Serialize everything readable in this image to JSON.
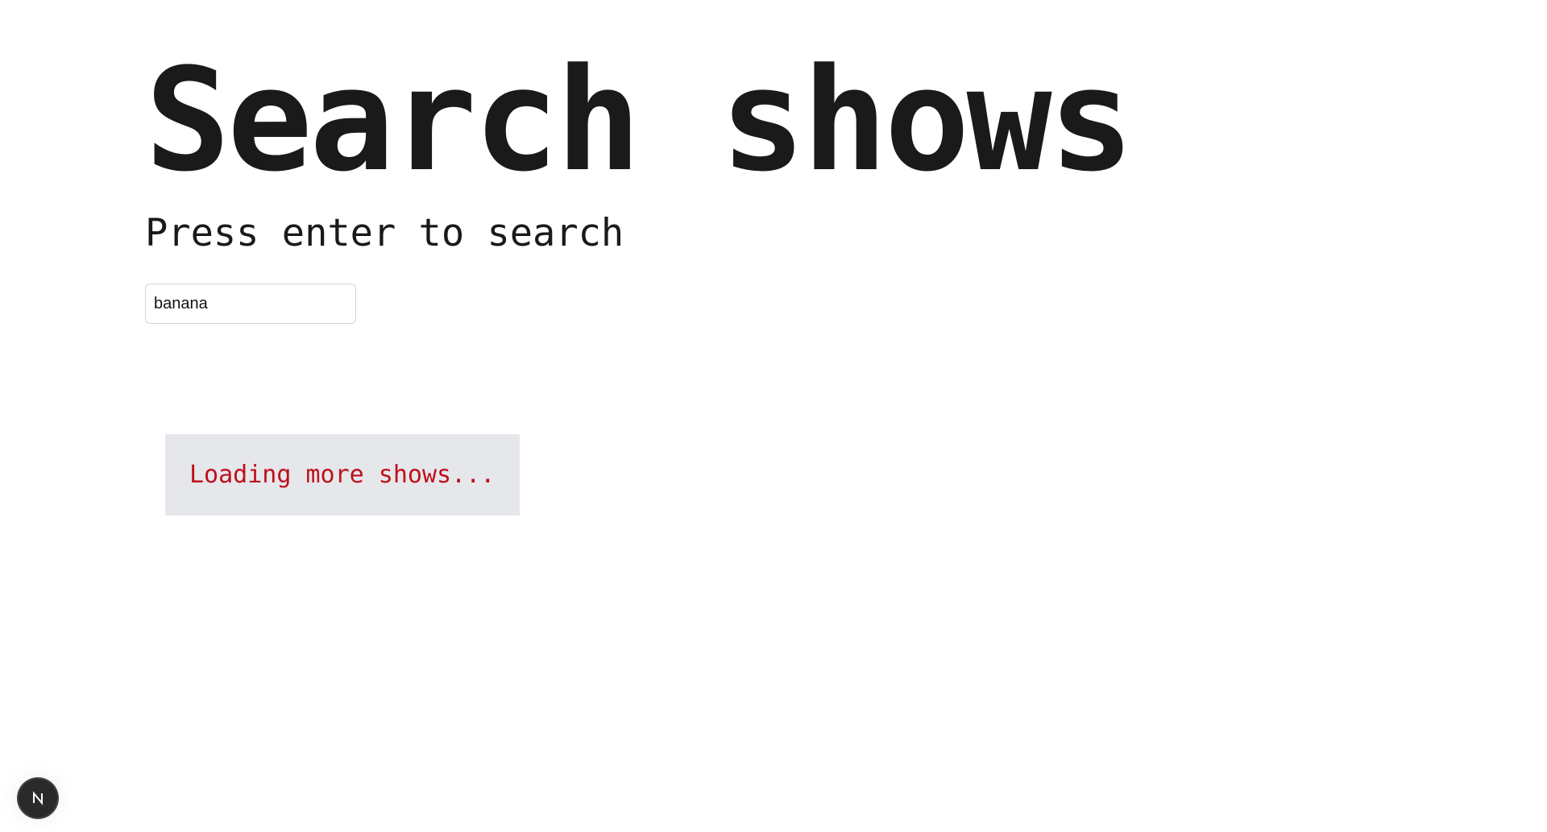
{
  "header": {
    "title": "Search shows",
    "subtitle": "Press enter to search"
  },
  "search": {
    "value": "banana",
    "placeholder": ""
  },
  "status": {
    "loading_text": "Loading more shows..."
  },
  "devtools": {
    "icon": "nextjs-logo-icon"
  },
  "colors": {
    "loading_text": "#c0101a",
    "loading_bg": "#e5e7eb",
    "title": "#1a1a1a",
    "badge_bg": "#2a2a2a"
  }
}
